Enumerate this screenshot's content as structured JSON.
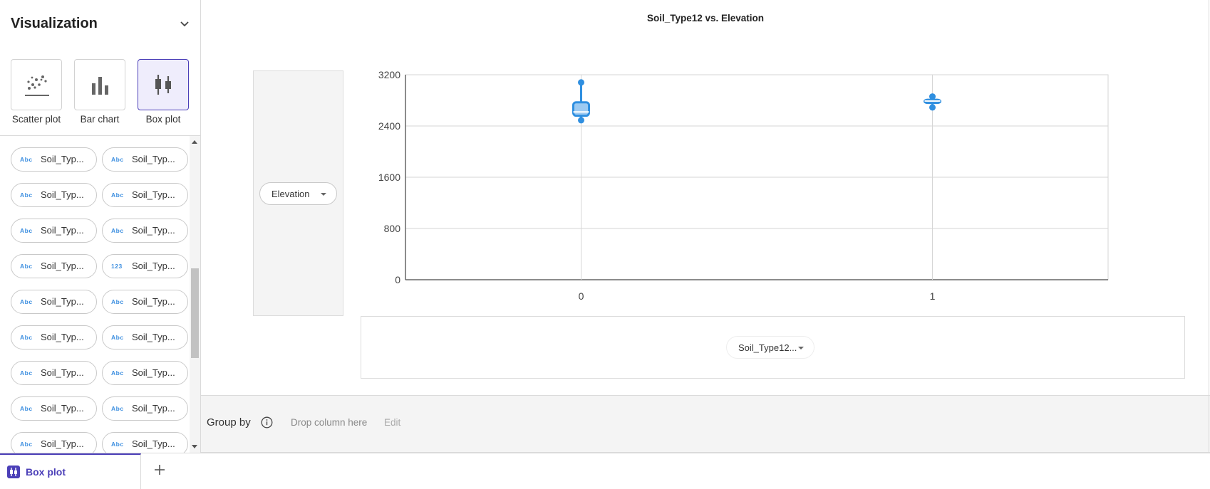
{
  "sidebar": {
    "title": "Visualization",
    "viz_types": [
      {
        "label": "Scatter plot",
        "icon": "scatter-plot-icon"
      },
      {
        "label": "Bar chart",
        "icon": "bar-chart-icon"
      },
      {
        "label": "Box plot",
        "icon": "box-plot-icon",
        "selected": true
      }
    ],
    "columns": [
      {
        "type": "Abc",
        "label": "Soil_Typ..."
      },
      {
        "type": "Abc",
        "label": "Soil_Typ..."
      },
      {
        "type": "Abc",
        "label": "Soil_Typ..."
      },
      {
        "type": "Abc",
        "label": "Soil_Typ..."
      },
      {
        "type": "Abc",
        "label": "Soil_Typ..."
      },
      {
        "type": "Abc",
        "label": "Soil_Typ..."
      },
      {
        "type": "Abc",
        "label": "Soil_Typ..."
      },
      {
        "type": "123",
        "label": "Soil_Typ..."
      },
      {
        "type": "Abc",
        "label": "Soil_Typ..."
      },
      {
        "type": "Abc",
        "label": "Soil_Typ..."
      },
      {
        "type": "Abc",
        "label": "Soil_Typ..."
      },
      {
        "type": "Abc",
        "label": "Soil_Typ..."
      },
      {
        "type": "Abc",
        "label": "Soil_Typ..."
      },
      {
        "type": "Abc",
        "label": "Soil_Typ..."
      },
      {
        "type": "Abc",
        "label": "Soil_Typ..."
      },
      {
        "type": "Abc",
        "label": "Soil_Typ..."
      },
      {
        "type": "Abc",
        "label": "Soil_Typ..."
      },
      {
        "type": "Abc",
        "label": "Soil_Typ..."
      }
    ]
  },
  "main": {
    "y_selector": "Elevation",
    "x_selector": "Soil_Type12..."
  },
  "group_by": {
    "label": "Group by",
    "placeholder": "Drop column here",
    "edit_label": "Edit"
  },
  "tabs": [
    {
      "label": "Box plot",
      "active": true
    }
  ],
  "colors": {
    "accent": "#4b3fb8",
    "box_fill": "#9ccaf2",
    "box_stroke": "#2f8fe0"
  },
  "chart_data": {
    "type": "box",
    "title": "Soil_Type12 vs. Elevation",
    "xlabel": "",
    "ylabel": "",
    "categories": [
      "0",
      "1"
    ],
    "boxes": [
      {
        "category": "0",
        "min": 2490,
        "q1": 2560,
        "median": 2620,
        "q3": 2770,
        "max": 3080
      },
      {
        "category": "1",
        "min": 2690,
        "q1": 2760,
        "median": 2790,
        "q3": 2810,
        "max": 2860
      }
    ],
    "ylim": [
      0,
      3200
    ],
    "yticks": [
      0,
      800,
      1600,
      2400,
      3200
    ],
    "grid": true
  }
}
